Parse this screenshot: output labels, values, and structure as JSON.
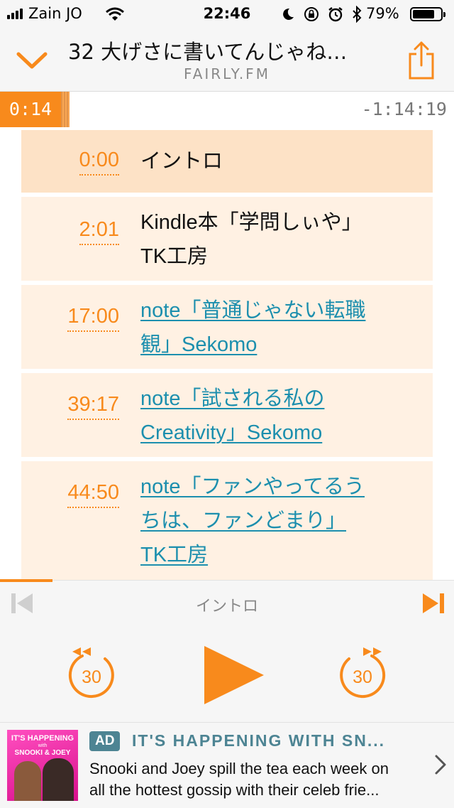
{
  "status_bar": {
    "carrier": "Zain JO",
    "time": "22:46",
    "battery": "79%",
    "battery_level": 0.79,
    "icons": [
      "signal-icon",
      "wifi-icon",
      "moon-icon",
      "orientation-lock-icon",
      "alarm-icon",
      "bluetooth-icon",
      "battery-icon"
    ]
  },
  "header": {
    "title": "32 大げさに書いてんじゃね…",
    "podcast": "FAIRLY.FM",
    "icons": [
      "chevron-down-icon",
      "share-icon"
    ]
  },
  "progress": {
    "elapsed": "0:14",
    "remaining": "-1:14:19"
  },
  "chapters": [
    {
      "time": "0:00",
      "lines": [
        "イントロ"
      ],
      "link": false,
      "active": true
    },
    {
      "time": "2:01",
      "lines": [
        "Kindle本「学問しぃや」",
        "TK工房"
      ],
      "link": false,
      "active": false
    },
    {
      "time": "17:00",
      "lines": [
        "note「普通じゃない転職",
        "観」Sekomo"
      ],
      "link": true,
      "active": false
    },
    {
      "time": "39:17",
      "lines": [
        "note「試される私の",
        "Creativity」Sekomo"
      ],
      "link": true,
      "active": false
    },
    {
      "time": "44:50",
      "lines": [
        "note「ファンやってるう",
        "ちは、ファンどまり」",
        "TK工房"
      ],
      "link": true,
      "active": false
    }
  ],
  "player": {
    "current_chapter": "イントロ",
    "skip_back": "30",
    "skip_forward": "30",
    "accent": "#f88a1c",
    "icons": [
      "previous-chapter-icon",
      "next-chapter-icon",
      "rewind-30-icon",
      "play-icon",
      "forward-30-icon"
    ]
  },
  "ad": {
    "badge": "AD",
    "title": "IT'S HAPPENING WITH SN...",
    "desc_lines": [
      "Snooki and Joey spill the tea each week on",
      "all the hottest gossip with their celeb frie..."
    ],
    "art_lines": [
      "IT'S HAPPENING",
      "with",
      "SNOOKI & JOEY"
    ],
    "icons": [
      "chevron-right-icon"
    ]
  }
}
